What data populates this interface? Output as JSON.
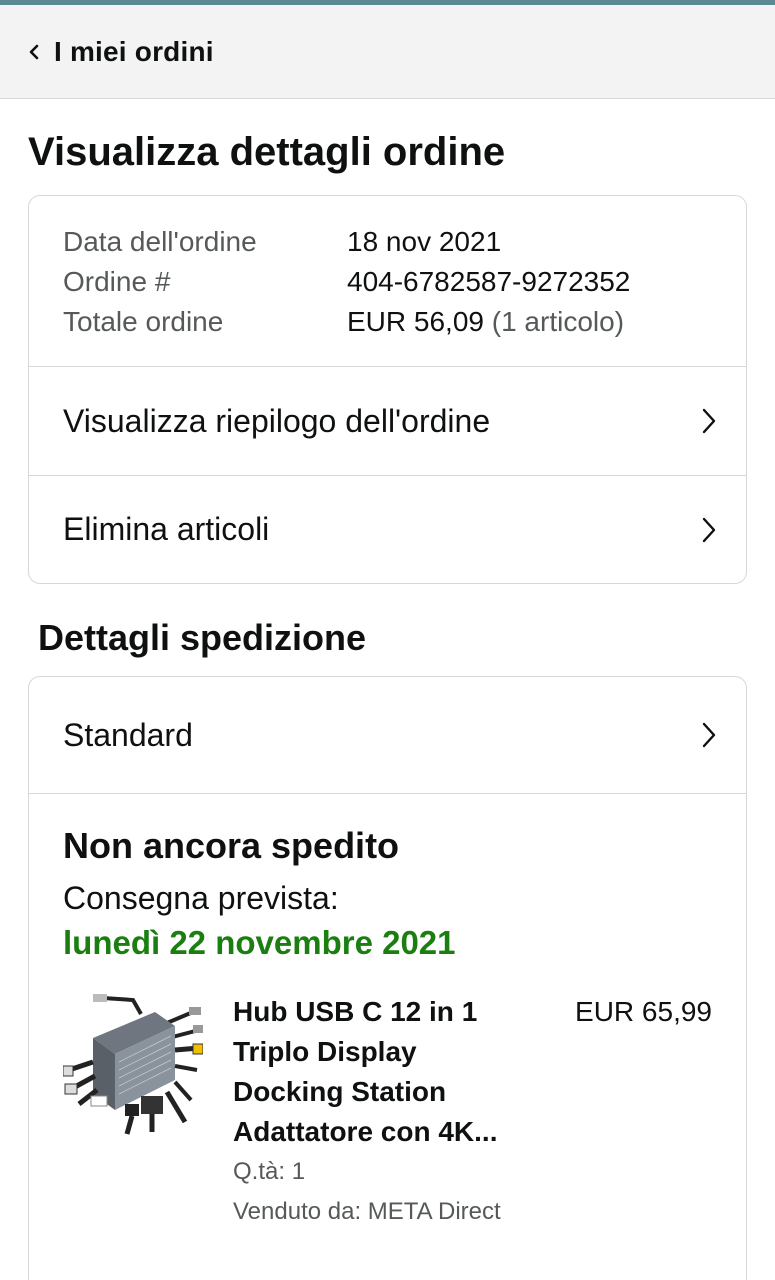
{
  "header": {
    "back_label": "I miei ordini"
  },
  "page": {
    "title": "Visualizza dettagli ordine"
  },
  "order": {
    "date_label": "Data dell'ordine",
    "date_value": "18 nov 2021",
    "number_label": "Ordine #",
    "number_value": "404-6782587-9272352",
    "total_label": "Totale ordine",
    "total_value": "EUR 56,09",
    "total_items": "(1 articolo)",
    "links": [
      {
        "label": "Visualizza riepilogo dell'ordine"
      },
      {
        "label": "Elimina articoli"
      }
    ]
  },
  "shipping": {
    "section_title": "Dettagli spedizione",
    "method": "Standard",
    "status": "Non ancora spedito",
    "delivery_label": "Consegna prevista:",
    "delivery_date": "lunedì 22 novembre 2021",
    "delivery_color": "#1a7f10",
    "item": {
      "title_lines": [
        "Hub USB C 12 in 1",
        "Triplo Display",
        "Docking Station",
        "Adattatore con 4K..."
      ],
      "price": "EUR 65,99",
      "quantity": "Q.tà: 1",
      "seller": "Venduto da: META Direct"
    }
  },
  "icons": {
    "back": "chevron-left-icon",
    "row_arrow": "chevron-right-icon"
  }
}
